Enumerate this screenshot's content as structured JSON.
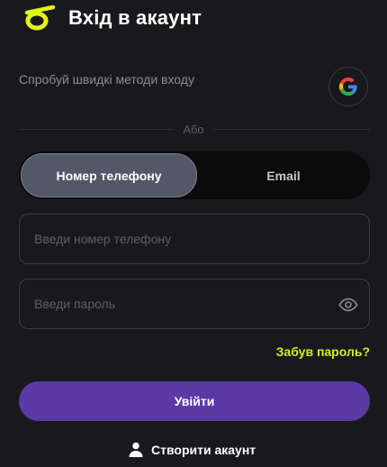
{
  "header": {
    "title": "Вхід в акаунт",
    "logo_icon": "brand-logo-icon",
    "brand_color": "#e2f21d"
  },
  "quick_login": {
    "text": "Спробуй швидкі методи входу",
    "google_icon": "google-icon"
  },
  "divider": {
    "label": "Або"
  },
  "login_tabs": {
    "options": [
      "Номер телефону",
      "Email"
    ],
    "selected": "Номер телефону"
  },
  "phone_field": {
    "placeholder": "Введи номер телефону",
    "value": ""
  },
  "password_field": {
    "placeholder": "Введи пароль",
    "value": "",
    "toggle_icon": "eye-icon"
  },
  "forgot_link": "Забув пароль?",
  "login_button": {
    "label": "Увійти",
    "color": "#5b3aa6"
  },
  "create_account": {
    "label": "Створити акаунт",
    "icon": "user-icon"
  },
  "colors": {
    "background": "#19191d",
    "accent": "#d6ec2c"
  }
}
